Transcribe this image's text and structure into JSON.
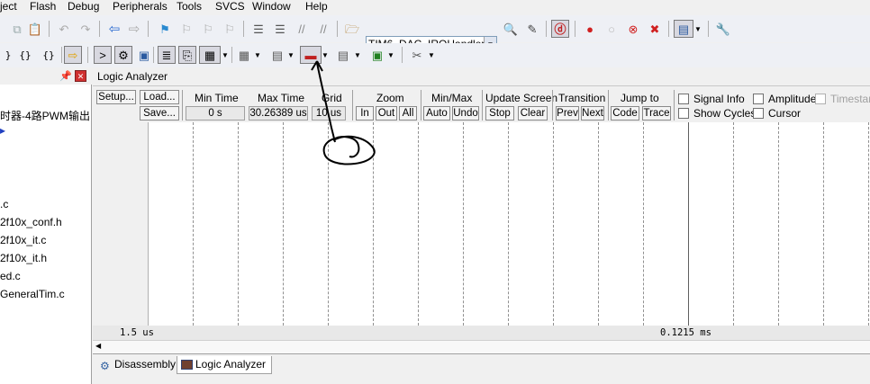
{
  "menu": [
    "ject",
    "Flash",
    "Debug",
    "Peripherals",
    "Tools",
    "SVCS",
    "Window",
    "Help"
  ],
  "toolbar": {
    "function_combo_value": "TIM6_DAC_IRQHandler"
  },
  "project_tree": {
    "items": [
      "时器-4路PWM输出",
      "",
      ".c",
      "2f10x_conf.h",
      "2f10x_it.c",
      "2f10x_it.h",
      "ed.c",
      "GeneralTim.c"
    ]
  },
  "logic_analyzer": {
    "title": "Logic Analyzer",
    "setup_label": "Setup...",
    "load_label": "Load...",
    "save_label": "Save...",
    "min_time_label": "Min Time",
    "min_time_value": "0 s",
    "max_time_label": "Max Time",
    "max_time_value": "30.26389 us",
    "grid_label": "Grid",
    "grid_value": "10 us",
    "zoom_label": "Zoom",
    "zoom_in": "In",
    "zoom_out": "Out",
    "zoom_all": "All",
    "minmax_label": "Min/Max",
    "auto_label": "Auto",
    "undo_label": "Undo",
    "update_label": "Update Screen",
    "stop_label": "Stop",
    "clear_label": "Clear",
    "transition_label": "Transition",
    "prev_label": "Prev",
    "next_label": "Next",
    "jump_label": "Jump to",
    "code_label": "Code",
    "trace_label": "Trace",
    "signal_info_label": "Signal Info",
    "show_cycles_label": "Show Cycles",
    "amplitude_label": "Amplitude",
    "cursor_label": "Cursor",
    "timestamp_label": "Timestam",
    "ruler_left": "1.5 us",
    "ruler_right": "0.1215 ms"
  },
  "tabs": [
    "Disassembly",
    "Logic Analyzer"
  ],
  "colors": {
    "annotation": "#000000",
    "toolbar_bg": "#eef0f5",
    "record_red": "#d02020"
  }
}
